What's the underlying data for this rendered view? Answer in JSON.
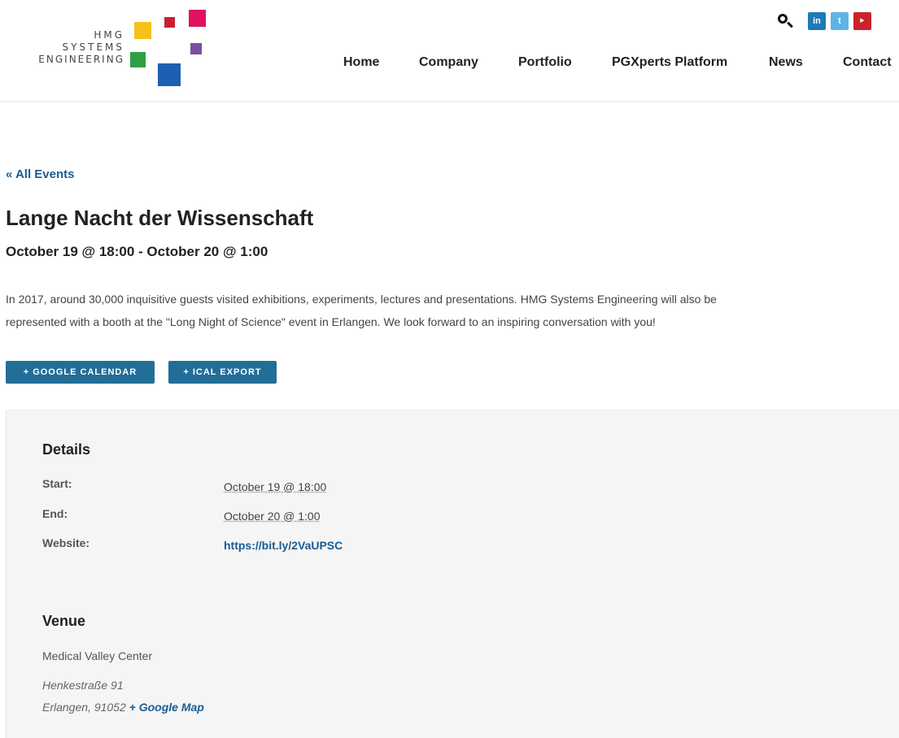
{
  "logo": {
    "line1": "HMG",
    "line2": "SYSTEMS",
    "line3": "ENGINEERING",
    "colors": [
      "#f4c21a",
      "#c8202f",
      "#e0125f",
      "#2ea043",
      "#7b4fa0",
      "#1d5fb0"
    ]
  },
  "header": {
    "icons": {
      "search": "search-icon",
      "linkedin": "in",
      "twitter": "t",
      "youtube": "You Tube"
    }
  },
  "nav": {
    "items": [
      {
        "label": "Home"
      },
      {
        "label": "Company"
      },
      {
        "label": "Portfolio"
      },
      {
        "label": "PGXperts Platform"
      },
      {
        "label": "News"
      },
      {
        "label": "Contact"
      }
    ]
  },
  "event": {
    "back_link": "« All Events",
    "title": "Lange Nacht der Wissenschaft",
    "date": "October 19 @ 18:00 - October 20 @ 1:00",
    "description_line1": "In 2017, around 30,000 inquisitive guests visited exhibitions, experiments, lectures and presentations. HMG Systems Engineering will also be",
    "description_line2": "represented with a booth at the \"Long Night of Science\" event in Erlangen. We look forward to an inspiring conversation with you!",
    "google_calendar_button": "+ GOOGLE CALENDAR",
    "ical_export_button": "+ ICAL EXPORT"
  },
  "details": {
    "heading": "Details",
    "start_label": "Start:",
    "start_value": "October 19 @ 18:00",
    "end_label": "End:",
    "end_value": "October 20 @ 1:00",
    "website_label": "Website:",
    "website_value": "https://bit.ly/2VaUPSC"
  },
  "venue": {
    "heading": "Venue",
    "name": "Medical Valley Center",
    "street": "Henkestraße 91",
    "city": "Erlangen, 91052",
    "map_link": "+ Google Map"
  },
  "colors": {
    "accent_link": "#1a5b94",
    "button": "#226e99",
    "panel_bg": "#f5f5f5"
  }
}
